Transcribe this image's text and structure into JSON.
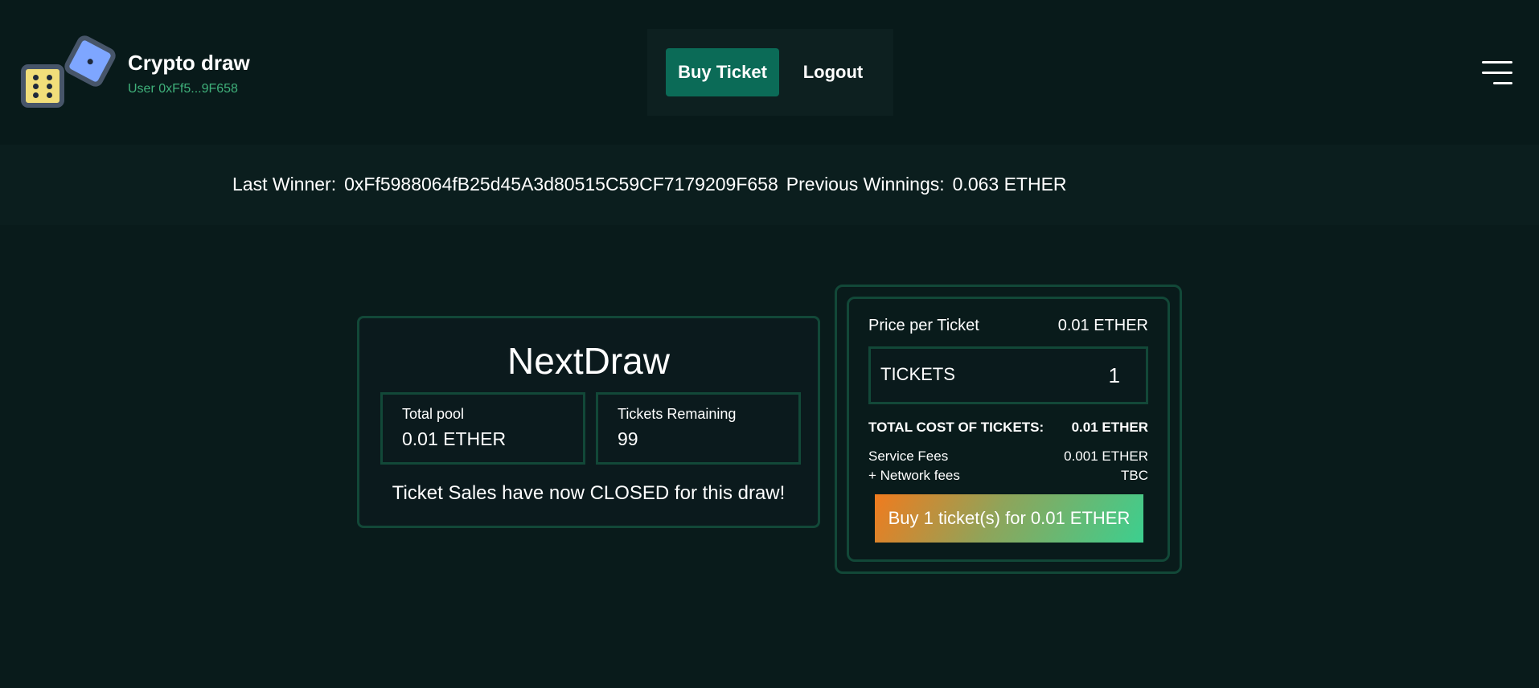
{
  "header": {
    "brand_title": "Crypto draw",
    "user_label": "User 0xFf5...9F658",
    "nav": {
      "buy_ticket_label": "Buy Ticket",
      "logout_label": "Logout"
    },
    "menu_icon": "hamburger-menu-icon"
  },
  "winner_bar": {
    "last_winner_label": "Last Winner:",
    "last_winner_address": "0xFf5988064fB25d45A3d80515C59CF7179209F658",
    "previous_winnings_label": "Previous Winnings:",
    "previous_winnings_value": "0.063 ETHER"
  },
  "next_draw": {
    "title": "NextDraw",
    "total_pool_label": "Total pool",
    "total_pool_value": "0.01 ETHER",
    "tickets_remaining_label": "Tickets Remaining",
    "tickets_remaining_value": "99",
    "status_message": "Ticket Sales have now CLOSED for this draw!"
  },
  "purchase": {
    "price_label": "Price per Ticket",
    "price_value": "0.01 ETHER",
    "tickets_label": "TICKETS",
    "tickets_value": "1",
    "total_cost_label": "TOTAL COST OF TICKETS:",
    "total_cost_value": "0.01 ETHER",
    "service_fees_label": "Service Fees",
    "service_fees_value": "0.001 ETHER",
    "network_fees_label": "+ Network fees",
    "network_fees_value": "TBC",
    "buy_button_label": "Buy 1 ticket(s) for 0.01 ETHER"
  },
  "colors": {
    "background": "#091b1b",
    "accent_green": "#0b6b57",
    "border_green": "#124838",
    "user_text_green": "#3fb07a",
    "button_gradient_start": "#f07b1e",
    "button_gradient_end": "#3ccf8f"
  }
}
